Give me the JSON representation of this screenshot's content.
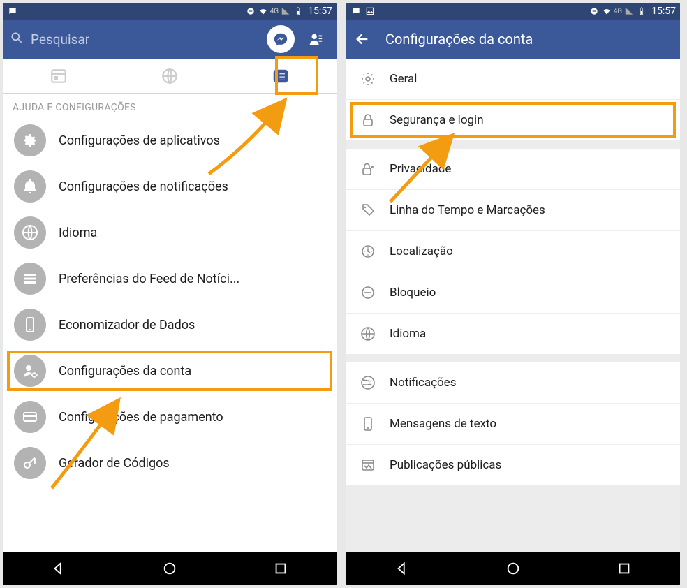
{
  "status": {
    "network_label": "4G",
    "time": "15:57"
  },
  "left": {
    "search_placeholder": "Pesquisar",
    "section_title": "AJUDA E CONFIGURAÇÕES",
    "menu": [
      {
        "label": "Configurações de aplicativos",
        "icon": "gear"
      },
      {
        "label": "Configurações de notificações",
        "icon": "bell"
      },
      {
        "label": "Idioma",
        "icon": "globe"
      },
      {
        "label": "Preferências do Feed de Notíci...",
        "icon": "list"
      },
      {
        "label": "Economizador de Dados",
        "icon": "phone"
      },
      {
        "label": "Configurações da conta",
        "icon": "user-gear",
        "highlighted": true
      },
      {
        "label": "Configurações de pagamento",
        "icon": "card"
      },
      {
        "label": "Gerador de Códigos",
        "icon": "key"
      }
    ]
  },
  "right": {
    "title": "Configurações da conta",
    "groups": [
      [
        {
          "label": "Geral",
          "icon": "gear"
        },
        {
          "label": "Segurança e login",
          "icon": "lock",
          "highlighted": true
        }
      ],
      [
        {
          "label": "Privacidade",
          "icon": "lock-plus"
        },
        {
          "label": "Linha do Tempo e Marcações",
          "icon": "tag"
        },
        {
          "label": "Localização",
          "icon": "location"
        },
        {
          "label": "Bloqueio",
          "icon": "block"
        },
        {
          "label": "Idioma",
          "icon": "globe"
        }
      ],
      [
        {
          "label": "Notificações",
          "icon": "world"
        },
        {
          "label": "Mensagens de texto",
          "icon": "phone"
        },
        {
          "label": "Publicações públicas",
          "icon": "feed"
        }
      ]
    ]
  }
}
